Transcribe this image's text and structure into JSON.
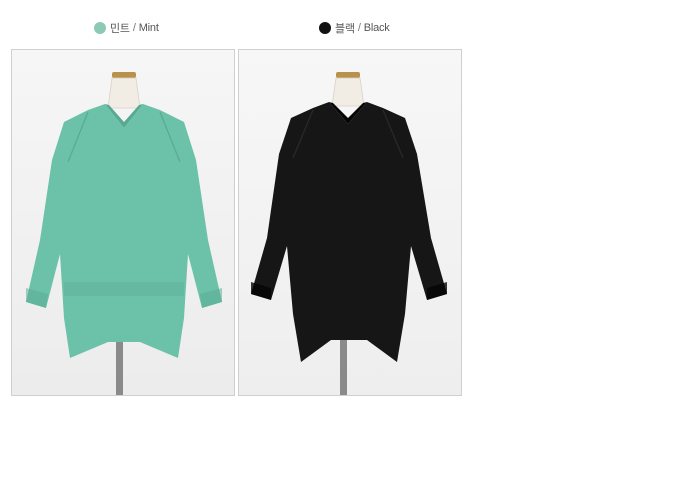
{
  "colors": [
    {
      "name_ko": "민트",
      "separator": "/",
      "name_en": "Mint",
      "swatch": "#8ec9b4",
      "garment": "#6cc2a8",
      "garment_shadow": "#57a992"
    },
    {
      "name_ko": "블랙",
      "separator": "/",
      "name_en": "Black",
      "swatch": "#111111",
      "garment": "#161616",
      "garment_shadow": "#050505"
    }
  ]
}
